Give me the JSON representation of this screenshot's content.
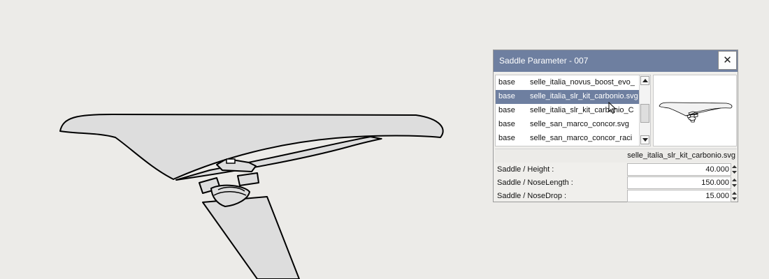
{
  "dialog": {
    "title": "Saddle Parameter - 007",
    "close_icon": "close-icon",
    "list": {
      "rows": [
        {
          "type": "base",
          "file": "selle_italia_novus_boost_evo_"
        },
        {
          "type": "base",
          "file": "selle_italia_slr_kit_carbonio.svg"
        },
        {
          "type": "base",
          "file": "selle_italia_slr_kit_carbonio_C"
        },
        {
          "type": "base",
          "file": "selle_san_marco_concor.svg"
        },
        {
          "type": "base",
          "file": "selle_san_marco_concor_raci"
        }
      ],
      "selected_index": 1
    },
    "selected_filename": "selle_italia_slr_kit_carbonio.svg",
    "params": [
      {
        "label": "Saddle / Height :",
        "value": "40.000"
      },
      {
        "label": "Saddle / NoseLength :",
        "value": "150.000"
      },
      {
        "label": "Saddle / NoseDrop :",
        "value": "15.000"
      }
    ]
  },
  "colors": {
    "titlebar": "#6e7fa0",
    "selection": "#6e7fa0",
    "saddle_fill": "#dddddd",
    "canvas_bg": "#ecebe8"
  }
}
